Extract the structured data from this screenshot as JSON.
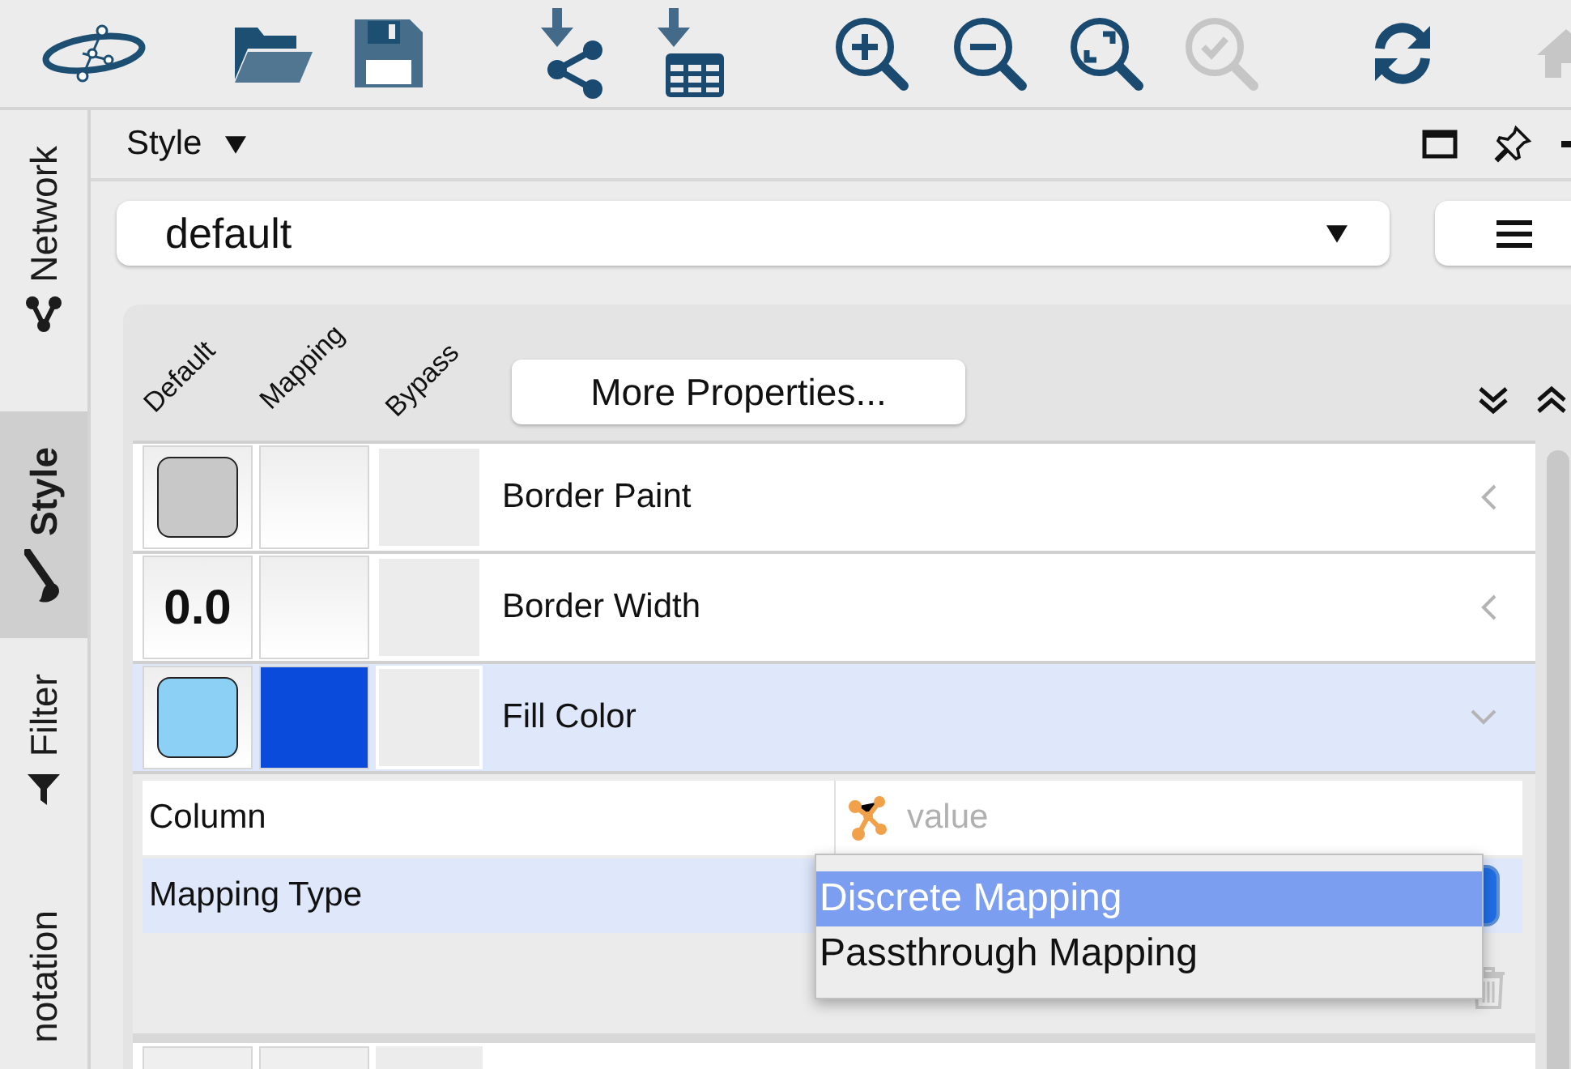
{
  "toolbar": [
    {
      "kind": "logo",
      "disabled": false
    },
    {
      "kind": "open",
      "disabled": false
    },
    {
      "kind": "save",
      "disabled": false
    },
    {
      "kind": "import-network",
      "disabled": false
    },
    {
      "kind": "import-table",
      "disabled": false
    },
    {
      "kind": "zoom-in",
      "disabled": false
    },
    {
      "kind": "zoom-out",
      "disabled": false
    },
    {
      "kind": "zoom-fit",
      "disabled": false
    },
    {
      "kind": "zoom-selected",
      "disabled": true
    },
    {
      "kind": "refresh",
      "disabled": false
    },
    {
      "kind": "home",
      "disabled": true
    }
  ],
  "side_tabs": [
    {
      "label": "Network",
      "kind": "network",
      "selected": false
    },
    {
      "label": "Style",
      "kind": "brush",
      "selected": true
    },
    {
      "label": "Filter",
      "kind": "filter",
      "selected": false
    },
    {
      "label": "notation",
      "kind": "none",
      "selected": false
    }
  ],
  "panel": {
    "title": "Style",
    "style_selector": {
      "value": "default"
    },
    "column_headers": [
      "Default",
      "Mapping",
      "Bypass"
    ],
    "more_button": "More Properties...",
    "properties": [
      {
        "label": "Border Paint",
        "default": {
          "kind": "color",
          "color": "#c8c8c8"
        },
        "selected": false,
        "expanded": false
      },
      {
        "label": "Border Width",
        "default": {
          "kind": "number",
          "value": "0.0"
        },
        "selected": false,
        "expanded": false
      },
      {
        "label": "Fill Color",
        "default": {
          "kind": "color",
          "color": "#8dd0f5"
        },
        "mapping": {
          "color": "#0a4bdc"
        },
        "selected": true,
        "expanded": true
      }
    ],
    "mapping": {
      "column_label": "Column",
      "column_value": "value",
      "type_label": "Mapping Type",
      "options": [
        {
          "label": "Discrete Mapping",
          "selected": true
        },
        {
          "label": "Passthrough Mapping",
          "selected": false
        }
      ]
    }
  }
}
